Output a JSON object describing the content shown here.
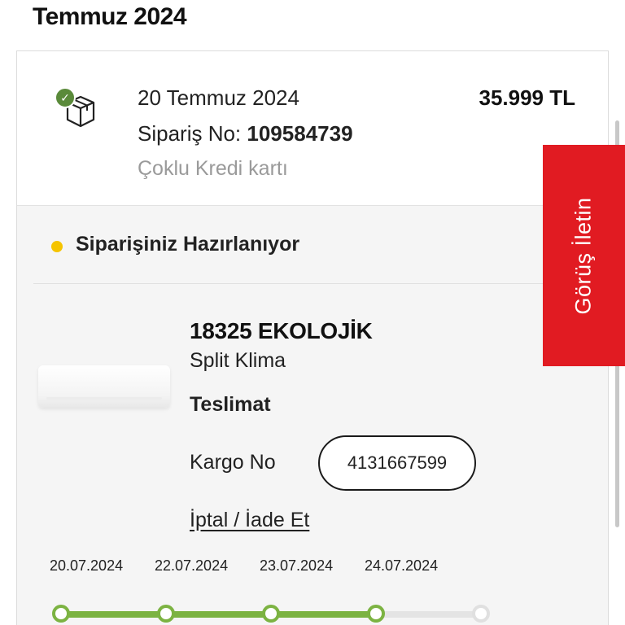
{
  "month": "Temmuz 2024",
  "order": {
    "date": "20 Temmuz 2024",
    "number_label": "Sipariş No:",
    "number": "109584739",
    "payment": "Çoklu Kredi kartı",
    "total": "35.999 TL",
    "status": "Siparişiniz Hazırlanıyor"
  },
  "product": {
    "name": "18325 EKOLOJİK",
    "subtitle": "Split Klima",
    "delivery_label": "Teslimat",
    "kargo_label": "Kargo No",
    "kargo_no": "4131667599",
    "cancel_link": "İptal / İade Et"
  },
  "timeline": {
    "dates": [
      "20.07.2024",
      "22.07.2024",
      "23.07.2024",
      "24.07.2024"
    ],
    "progress": 0.75,
    "steps_total": 5,
    "steps_done": 4
  },
  "feedback_tab": "Görüş İletin",
  "colors": {
    "accent_green": "#7cb342",
    "status_yellow": "#f5c400",
    "feedback_red": "#e11b22",
    "check_green": "#5a8a3a"
  },
  "icons": {
    "order_icon": "package-box-icon",
    "badge_icon": "checkmark-icon"
  }
}
